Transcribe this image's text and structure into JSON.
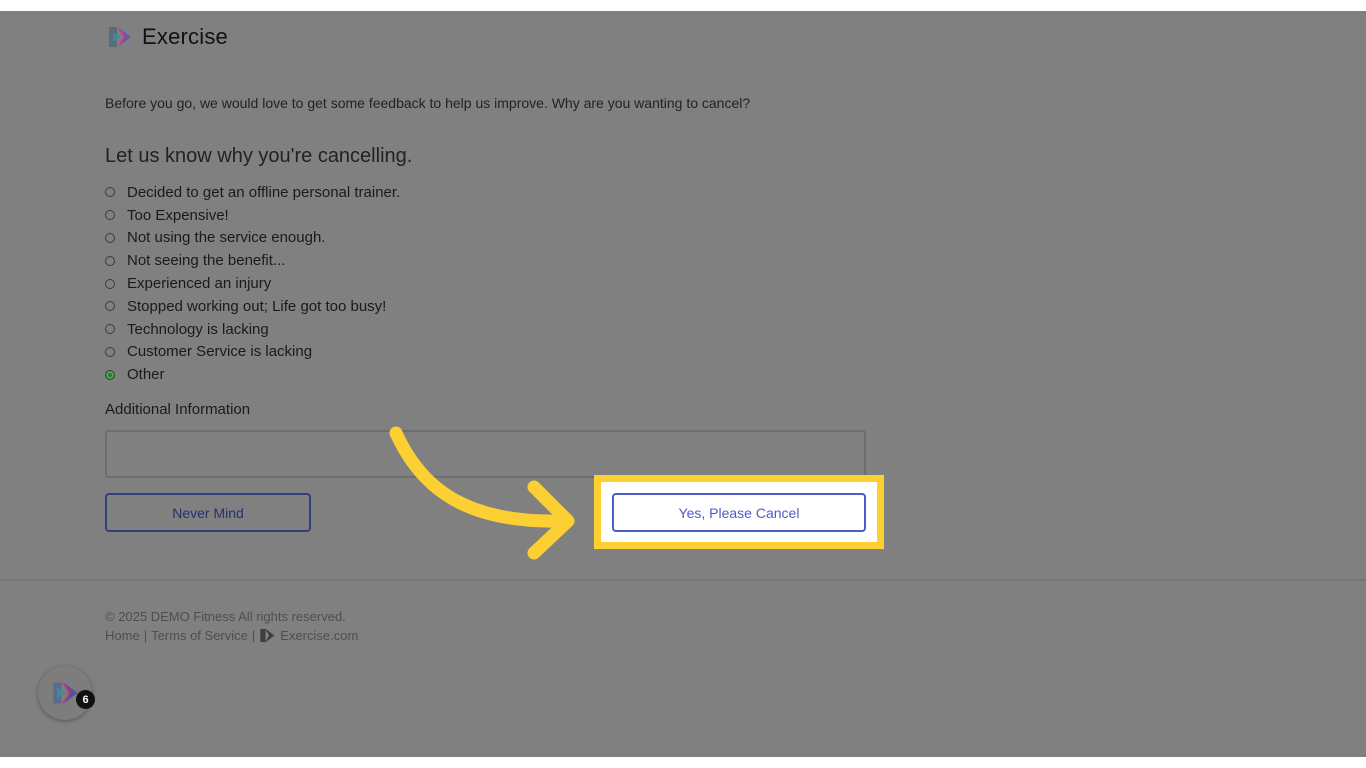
{
  "header": {
    "brand": "Exercise",
    "logo_icon": "exercise-logo-icon"
  },
  "intro_text": "Before you go, we would love to get some feedback to help us improve. Why are you wanting to cancel?",
  "form": {
    "heading": "Let us know why you're cancelling.",
    "reasons": [
      {
        "label": "Decided to get an offline personal trainer.",
        "checked": false
      },
      {
        "label": "Too Expensive!",
        "checked": false
      },
      {
        "label": "Not using the service enough.",
        "checked": false
      },
      {
        "label": "Not seeing the benefit...",
        "checked": false
      },
      {
        "label": "Experienced an injury",
        "checked": false
      },
      {
        "label": "Stopped working out; Life got too busy!",
        "checked": false
      },
      {
        "label": "Technology is lacking",
        "checked": false
      },
      {
        "label": "Customer Service is lacking",
        "checked": false
      },
      {
        "label": "Other",
        "checked": true
      }
    ],
    "additional_label": "Additional Information",
    "additional_value": "",
    "never_mind_label": "Never Mind",
    "confirm_label": "Yes, Please Cancel"
  },
  "footer": {
    "copyright": "© 2025 DEMO Fitness All rights reserved.",
    "links": {
      "home": "Home",
      "separator": "|",
      "terms": "Terms of Service",
      "exercise": "Exercise.com"
    }
  },
  "widget": {
    "badge_count": "6"
  },
  "colors": {
    "overlay": "#808080",
    "highlight": "#fccf33",
    "accent_blue": "#4a5ec5",
    "radio_checked": "#2d7a2d"
  }
}
